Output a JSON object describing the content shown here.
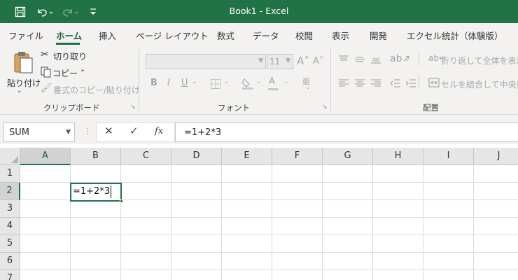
{
  "titlebar": {
    "title": "Book1  -  Excel",
    "icons": [
      "save-icon",
      "undo-icon",
      "redo-icon",
      "customize-qat-icon"
    ]
  },
  "tabs": {
    "items": [
      "ファイル",
      "ホーム",
      "挿入",
      "ページ レイアウト",
      "数式",
      "データ",
      "校閲",
      "表示",
      "開発",
      "エクセル統計（体験版）"
    ],
    "active": "ホーム"
  },
  "ribbon": {
    "clipboard": {
      "paste_label": "貼り付け",
      "cut_label": "切り取り",
      "copy_label": "コピー",
      "format_painter_label": "書式のコピー/貼り付け",
      "group_label": "クリップボード"
    },
    "font": {
      "font_size": "11",
      "bold": "B",
      "italic": "I",
      "underline": "U",
      "group_label": "フォント"
    },
    "alignment": {
      "wrap_text_label": "折り返して全体を表示す",
      "merge_center_label": "セルを結合して中央揃",
      "group_label": "配置"
    }
  },
  "formula_bar": {
    "name_box": "SUM",
    "cancel": "✕",
    "enter": "✓",
    "fx": "fx",
    "value": "=1+2*3"
  },
  "grid": {
    "columns": [
      "A",
      "B",
      "C",
      "D",
      "E",
      "F",
      "G",
      "H",
      "I",
      "J"
    ],
    "rows": [
      "1",
      "2",
      "3",
      "4",
      "5",
      "6",
      "7"
    ],
    "active_cell": {
      "column": "B",
      "row": "2",
      "content": "=1+2*3"
    }
  },
  "colors": {
    "accent": "#217346",
    "ribbon_bg": "#f3f2f1",
    "header_bg": "#e6e6e6"
  }
}
